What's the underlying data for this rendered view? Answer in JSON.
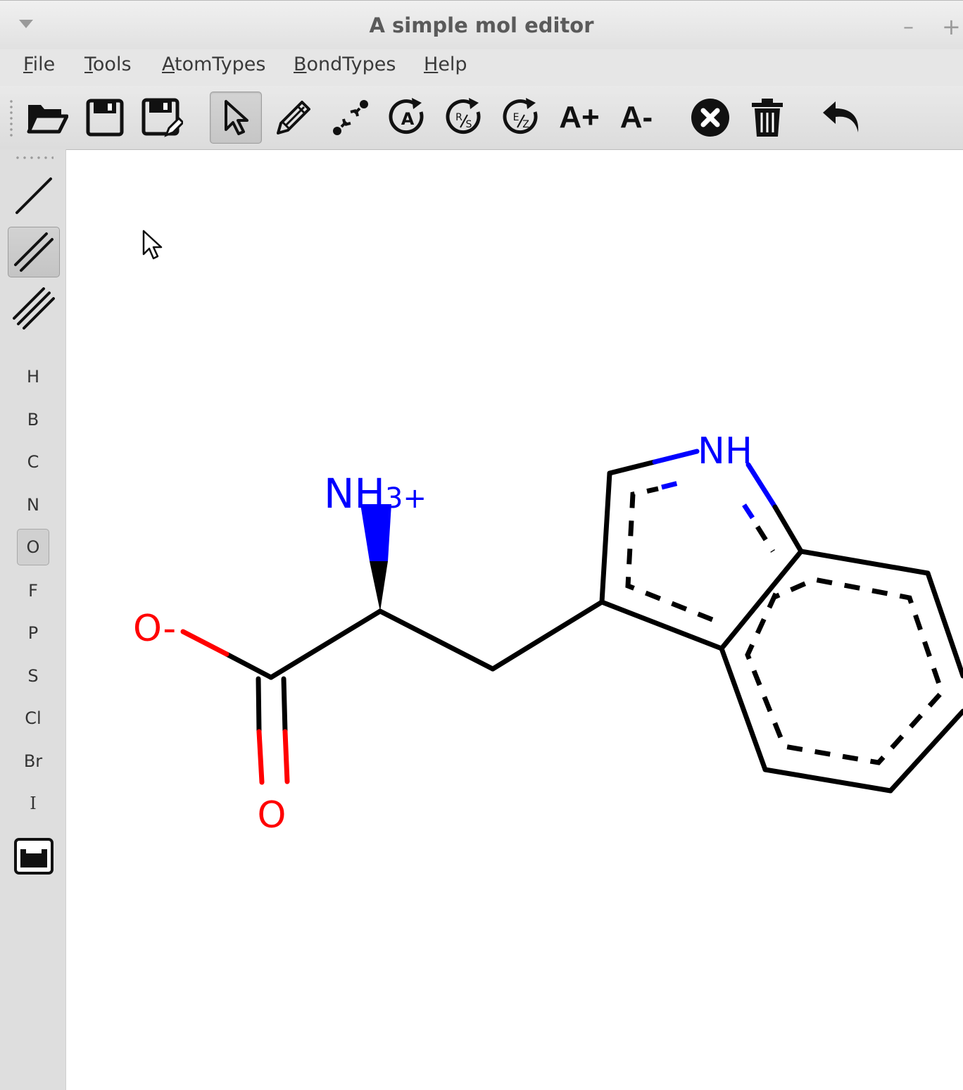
{
  "window": {
    "title": "A simple mol editor",
    "minimize_glyph": "–",
    "maximize_glyph": "+"
  },
  "menubar": {
    "items": [
      {
        "accel": "F",
        "rest": "ile"
      },
      {
        "accel": "T",
        "rest": "ools"
      },
      {
        "accel": "A",
        "rest": "tomTypes"
      },
      {
        "accel": "B",
        "rest": "ondTypes"
      },
      {
        "accel": "H",
        "rest": "elp"
      }
    ]
  },
  "toolbar": {
    "buttons": [
      {
        "icon": "folder-open-icon"
      },
      {
        "icon": "save-icon"
      },
      {
        "icon": "save-as-icon"
      },
      {
        "icon": "select-pointer-icon",
        "active": true
      },
      {
        "icon": "pencil-icon"
      },
      {
        "icon": "add-bond-icon"
      },
      {
        "icon": "circled-a-icon"
      },
      {
        "icon": "rs-stereo-icon"
      },
      {
        "icon": "ez-stereo-icon"
      },
      {
        "icon": "increase-charge-icon"
      },
      {
        "icon": "decrease-charge-icon"
      },
      {
        "icon": "remove-atom-icon"
      },
      {
        "icon": "trash-icon"
      },
      {
        "icon": "undo-icon"
      }
    ],
    "increase_charge_label": "A+",
    "decrease_charge_label": "A-"
  },
  "sidebar": {
    "bond_tools": [
      {
        "name": "single-bond",
        "active": false
      },
      {
        "name": "double-bond",
        "active": true
      },
      {
        "name": "triple-bond",
        "active": false
      }
    ],
    "elements": [
      "H",
      "B",
      "C",
      "N",
      "O",
      "F",
      "P",
      "S",
      "Cl",
      "Br",
      "I"
    ],
    "selected_element": "O",
    "periodic_table_icon": "periodic-table-icon"
  },
  "molecule": {
    "atom_labels": {
      "amine": {
        "main": "NH",
        "charge": "3+"
      },
      "carboxylate_oxygen": "O-",
      "carbonyl_oxygen": "O",
      "indole_nh": "NH"
    },
    "colors": {
      "carbon": "#000000",
      "nitrogen": "#0000ff",
      "oxygen": "#ff0000"
    }
  }
}
